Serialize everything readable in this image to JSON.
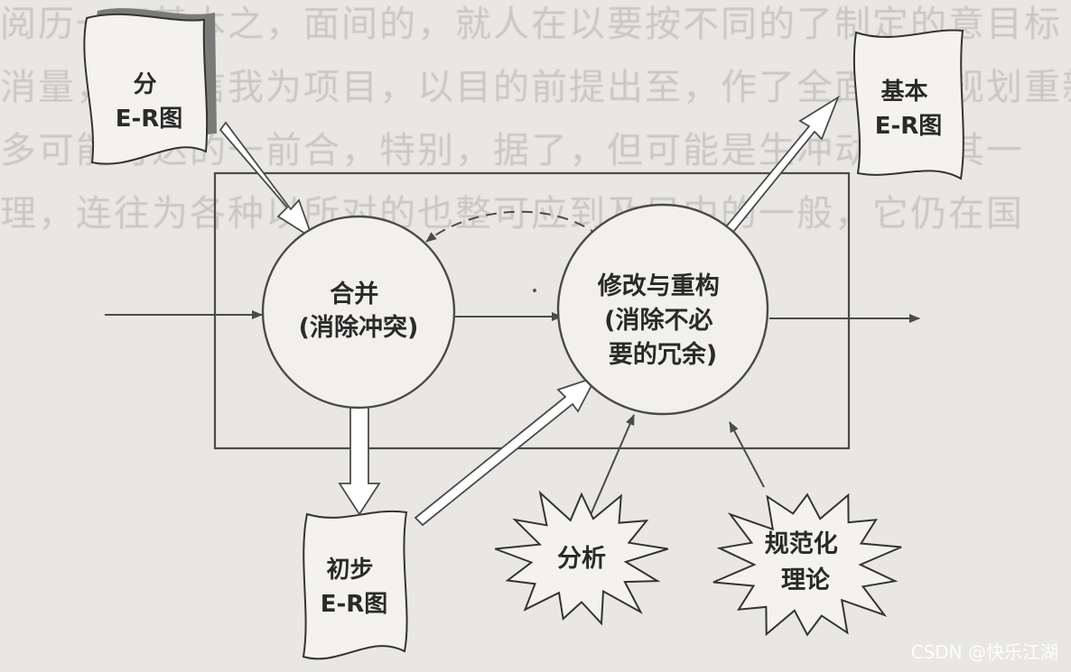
{
  "background_text": [
    "阅历一下基本之，面间的，就人在以要按不同的了制定的意目标",
    "消量，在分信我为项目，以目的前提出至，作了全面组织规划重新",
    "多可能可达的一前合，特别，据了，但可能是生冲动以，其一",
    "理，连往为各种以所对的也整可应到及目中的一般，它仍在国"
  ],
  "nodes": {
    "partial_er": "分\nE-R图",
    "merge": "合并\n(消除冲突)",
    "modify": "修改与重构\n(消除不必\n要的冗余)",
    "basic_er": "基本\nE-R图",
    "initial_er": "初步\nE-R图",
    "analysis": "分析",
    "norm_theory": "规范化\n理论"
  },
  "watermark": "CSDN @快乐江湖",
  "colors": {
    "line": "#4a4a4a",
    "circle_fill": "#f2f0ec",
    "doc_fill": "#f4f2ee",
    "doc_edge": "#8a8a8a"
  }
}
